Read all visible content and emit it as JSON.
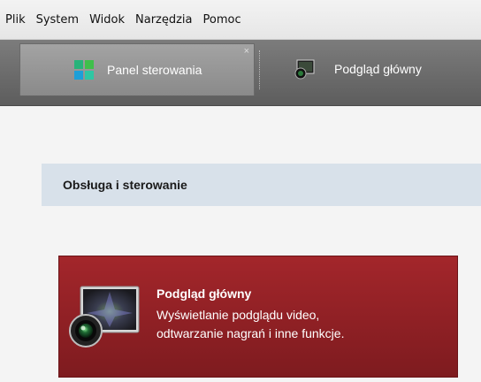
{
  "menu": [
    "Plik",
    "System",
    "Widok",
    "Narzędzia",
    "Pomoc"
  ],
  "tabs": {
    "active_label": "Panel sterowania",
    "active_close": "×",
    "other_label": "Podgląd główny"
  },
  "section": {
    "title": "Obsługa i sterowanie"
  },
  "tile": {
    "title": "Podgląd główny",
    "line1": "Wyświetlanie podglądu video,",
    "line2": "odtwarzanie nagrań i inne funkcje.",
    "color": "#8e2024"
  },
  "icons": {
    "control_panel": "grid-icon",
    "main_view": "monitor-camera-icon"
  }
}
